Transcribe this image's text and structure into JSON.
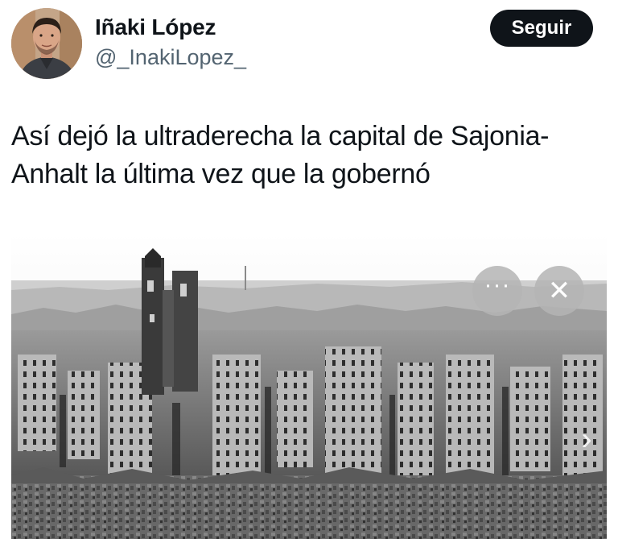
{
  "author": {
    "name": "Iñaki López",
    "handle": "@_InakiLopez_",
    "avatar_icon": "person-portrait-avatar"
  },
  "follow_button": {
    "label": "Seguir",
    "color": "#0f1419"
  },
  "tweet": {
    "text": "Así dejó la ultraderecha la capital de Sajonia-Anhalt la última vez que la gobernó"
  },
  "media": {
    "type": "black-and-white photograph",
    "icons": {
      "more": "more-horizontal-icon",
      "close": "close-icon",
      "next": "chevron-right-icon"
    },
    "more_glyph": "···",
    "close_glyph": "✕",
    "next_glyph": "›"
  },
  "colors": {
    "text": "#0f1419",
    "secondary": "#536471",
    "background": "#ffffff"
  }
}
